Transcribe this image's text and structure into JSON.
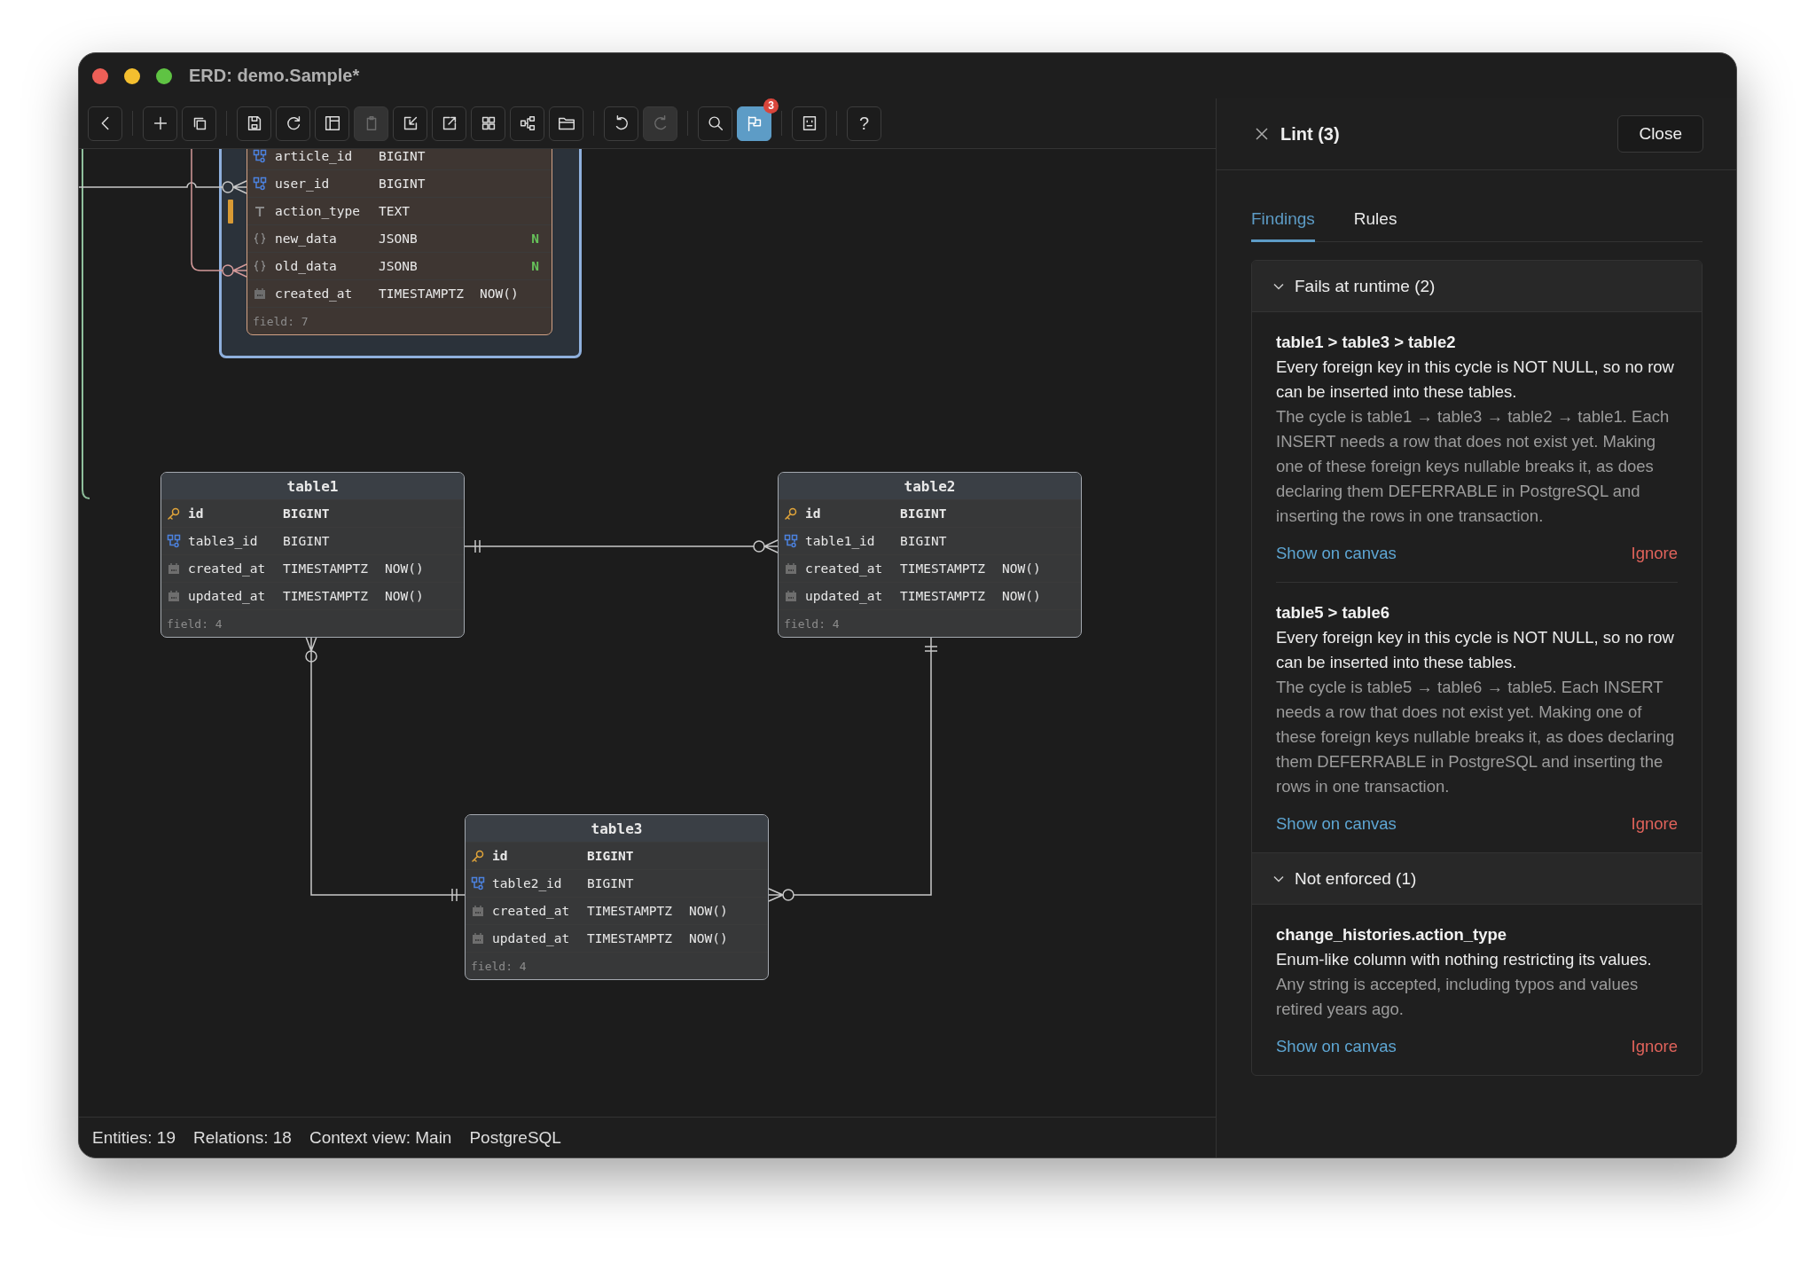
{
  "window": {
    "title": "ERD: demo.Sample*"
  },
  "toolbar": {
    "groups": [
      [
        {
          "disabled": false,
          "selected": false
        }
      ],
      [
        {
          "disabled": false,
          "selected": false
        },
        {
          "disabled": false,
          "selected": false
        }
      ],
      [
        {
          "disabled": false,
          "selected": false
        },
        {
          "disabled": false,
          "selected": false
        },
        {
          "disabled": false,
          "selected": false
        },
        {
          "disabled": true,
          "selected": false
        },
        {
          "disabled": false,
          "selected": false
        },
        {
          "disabled": false,
          "selected": false
        },
        {
          "disabled": false,
          "selected": false
        },
        {
          "disabled": false,
          "selected": false
        },
        {
          "disabled": false,
          "selected": false
        }
      ],
      [
        {
          "disabled": false,
          "selected": false
        },
        {
          "disabled": true,
          "selected": false
        }
      ],
      [
        {
          "disabled": false,
          "selected": false
        },
        {
          "disabled": false,
          "selected": true,
          "badge": "3"
        }
      ],
      [
        {
          "disabled": false,
          "selected": false
        }
      ],
      [
        {
          "disabled": false,
          "selected": false,
          "label": "?"
        }
      ]
    ]
  },
  "canvas": {
    "tables": [
      {
        "color": "#d2a285",
        "selected": true,
        "rows": [
          {
            "kind": "fk",
            "name": "article_id",
            "type": "BIGINT",
            "flagged": false
          },
          {
            "kind": "fk",
            "name": "user_id",
            "type": "BIGINT",
            "flagged": false
          },
          {
            "kind": "text",
            "name": "action_type",
            "type": "TEXT",
            "flagged": true
          },
          {
            "kind": "json",
            "name": "new_data",
            "type": "JSONB",
            "null_mark": "N",
            "flagged": false
          },
          {
            "kind": "json",
            "name": "old_data",
            "type": "JSONB",
            "null_mark": "N",
            "flagged": false
          },
          {
            "kind": "timestamp",
            "name": "created_at",
            "type": "TIMESTAMPTZ",
            "default": "NOW()",
            "flagged": false
          }
        ],
        "footer": "field: 7"
      },
      {
        "title": "table1",
        "color": "#a4a9b0",
        "selected": false,
        "rows": [
          {
            "kind": "pk",
            "name": "id",
            "type": "BIGINT"
          },
          {
            "kind": "fk",
            "name": "table3_id",
            "type": "BIGINT"
          },
          {
            "kind": "timestamp",
            "name": "created_at",
            "type": "TIMESTAMPTZ",
            "default": "NOW()"
          },
          {
            "kind": "timestamp",
            "name": "updated_at",
            "type": "TIMESTAMPTZ",
            "default": "NOW()"
          }
        ],
        "footer": "field: 4"
      },
      {
        "title": "table2",
        "color": "#a4a9b0",
        "selected": false,
        "rows": [
          {
            "kind": "pk",
            "name": "id",
            "type": "BIGINT"
          },
          {
            "kind": "fk",
            "name": "table1_id",
            "type": "BIGINT"
          },
          {
            "kind": "timestamp",
            "name": "created_at",
            "type": "TIMESTAMPTZ",
            "default": "NOW()"
          },
          {
            "kind": "timestamp",
            "name": "updated_at",
            "type": "TIMESTAMPTZ",
            "default": "NOW()"
          }
        ],
        "footer": "field: 4"
      },
      {
        "title": "table3",
        "color": "#a4a9b0",
        "selected": false,
        "rows": [
          {
            "kind": "pk",
            "name": "id",
            "type": "BIGINT"
          },
          {
            "kind": "fk",
            "name": "table2_id",
            "type": "BIGINT"
          },
          {
            "kind": "timestamp",
            "name": "created_at",
            "type": "TIMESTAMPTZ",
            "default": "NOW()"
          },
          {
            "kind": "timestamp",
            "name": "updated_at",
            "type": "TIMESTAMPTZ",
            "default": "NOW()"
          }
        ],
        "footer": "field: 4"
      }
    ]
  },
  "status_bar": [
    "Entities: 19",
    "Relations: 18",
    "Context view: Main",
    "PostgreSQL"
  ],
  "lint_panel": {
    "title": "Lint (3)",
    "close_button": "Close",
    "tabs": [
      {
        "label": "Findings",
        "selected": true
      },
      {
        "label": "Rules",
        "selected": false
      }
    ],
    "groups": [
      {
        "title": "Fails at runtime (2)",
        "expanded": true,
        "findings": [
          {
            "title": "table1 > table3 > table2",
            "summary": "Every foreign key in this cycle is NOT NULL, so no row can be inserted into these tables.",
            "detail": "The cycle is table1 → table3 → table2 → table1. Each INSERT needs a row that does not exist yet. Making one of these foreign keys nullable breaks it, as does declaring them DEFERRABLE in PostgreSQL and inserting the rows in one transaction.",
            "show_link": "Show on canvas",
            "ignore_link": "Ignore"
          },
          {
            "title": "table5 > table6",
            "summary": "Every foreign key in this cycle is NOT NULL, so no row can be inserted into these tables.",
            "detail": "The cycle is table5 → table6 → table5. Each INSERT needs a row that does not exist yet. Making one of these foreign keys nullable breaks it, as does declaring them DEFERRABLE in PostgreSQL and inserting the rows in one transaction.",
            "show_link": "Show on canvas",
            "ignore_link": "Ignore"
          }
        ]
      },
      {
        "title": "Not enforced (1)",
        "expanded": true,
        "findings": [
          {
            "title": "change_histories.action_type",
            "summary": "Enum-like column with nothing restricting its values.",
            "detail": "Any string is accepted, including typos and values retired years ago.",
            "show_link": "Show on canvas",
            "ignore_link": "Ignore"
          }
        ]
      }
    ]
  }
}
